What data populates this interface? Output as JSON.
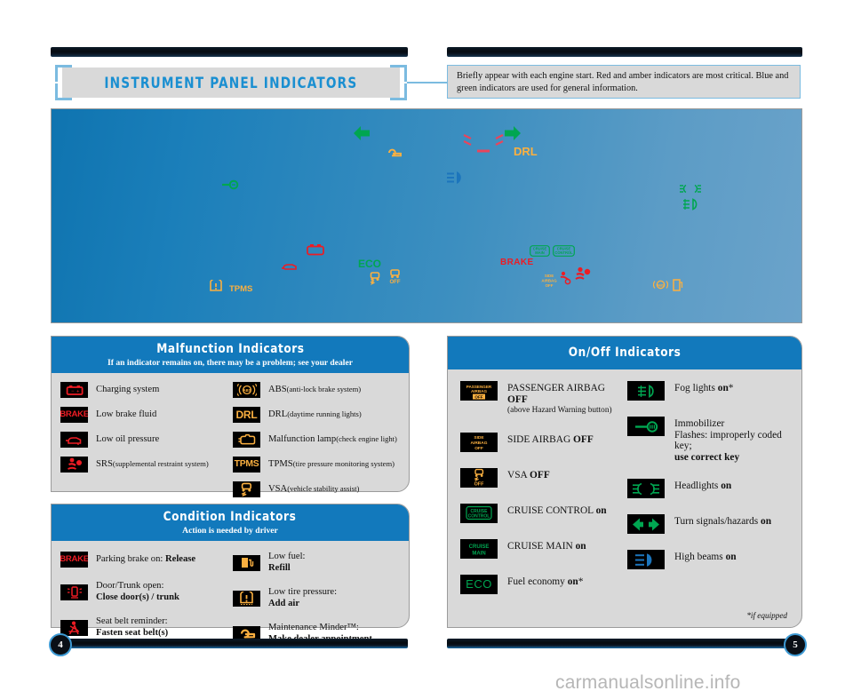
{
  "header": {
    "title": "INSTRUMENT PANEL INDICATORS",
    "callout": "Briefly appear with each engine start. Red and amber indicators are most critical. Blue and green indicators are used for general information."
  },
  "colors": {
    "header_blue": "#1279bc",
    "accent_light_blue": "#7bbbe0",
    "panel_gray": "#d9d9d9",
    "icon_red": "#ED1C24",
    "icon_amber": "#FBB040",
    "icon_green": "#00A651",
    "icon_blue": "#1C75BC",
    "dash_blue": "#1b7fba"
  },
  "dashboard": {
    "name": "instrument-cluster-illustration",
    "symbols": [
      {
        "id": "turn-left-arrow",
        "label": "",
        "color": "#00A651"
      },
      {
        "id": "maintenance-wrench",
        "label": "",
        "color": "#FBB040"
      },
      {
        "id": "seat-belt-pair",
        "label": "",
        "color": "#ED1C24"
      },
      {
        "id": "drl-text",
        "label": "DRL",
        "color": "#FBB040"
      },
      {
        "id": "turn-right-arrow",
        "label": "",
        "color": "#00A651"
      },
      {
        "id": "immobilizer-key",
        "label": "",
        "color": "#00A651"
      },
      {
        "id": "high-beam",
        "label": "",
        "color": "#1C75BC"
      },
      {
        "id": "headlights",
        "label": "",
        "color": "#00A651"
      },
      {
        "id": "fog-lights",
        "label": "",
        "color": "#00A651"
      },
      {
        "id": "low-oil-pressure",
        "label": "",
        "color": "#ED1C24"
      },
      {
        "id": "charging-system",
        "label": "",
        "color": "#ED1C24"
      },
      {
        "id": "eco-text",
        "label": "ECO",
        "color": "#00A651"
      },
      {
        "id": "vsa",
        "label": "",
        "color": "#FBB040"
      },
      {
        "id": "vsa-off",
        "label": "OFF",
        "color": "#FBB040"
      },
      {
        "id": "tpms",
        "label": "TPMS",
        "color": "#FBB040"
      },
      {
        "id": "cruise-main-box",
        "label": "CRUISE MAIN",
        "color": "#00A651"
      },
      {
        "id": "cruise-control-box",
        "label": "CRUISE CONTROL",
        "color": "#00A651"
      },
      {
        "id": "brake-text",
        "label": "BRAKE",
        "color": "#ED1C24"
      },
      {
        "id": "side-airbag-off",
        "label": "SIDE AIRBAG OFF",
        "color": "#FBB040"
      },
      {
        "id": "srs-small",
        "label": "",
        "color": "#ED1C24"
      },
      {
        "id": "srs",
        "label": "",
        "color": "#ED1C24"
      },
      {
        "id": "abs",
        "label": "",
        "color": "#FBB040"
      },
      {
        "id": "low-fuel",
        "label": "",
        "color": "#FBB040"
      }
    ]
  },
  "malfunction": {
    "title": "Malfunction Indicators",
    "subtitle": "If an indicator remains on, there may be a problem; see your dealer",
    "left_items": [
      {
        "icon": "charging-system-icon",
        "label": "Charging system",
        "note": ""
      },
      {
        "icon": "brake-icon",
        "label": "Low brake fluid",
        "note": ""
      },
      {
        "icon": "low-oil-pressure-icon",
        "label": "Low oil pressure",
        "note": ""
      },
      {
        "icon": "srs-icon",
        "label": "SRS",
        "note": "(supplemental restraint system)"
      }
    ],
    "right_items": [
      {
        "icon": "abs-icon",
        "label": "ABS",
        "note": "(anti-lock brake system)"
      },
      {
        "icon": "drl-icon",
        "label": "DRL",
        "note": "(daytime running lights)"
      },
      {
        "icon": "malfunction-lamp-icon",
        "label": "Malfunction lamp",
        "note": "(check engine light)"
      },
      {
        "icon": "tpms-icon",
        "label": "TPMS",
        "note": "(tire pressure monitoring system)"
      },
      {
        "icon": "vsa-icon",
        "label": "VSA",
        "note": "(vehicle stability assist)"
      }
    ]
  },
  "condition": {
    "title": "Condition Indicators",
    "subtitle": "Action is needed by driver",
    "left_items": [
      {
        "icon": "parking-brake-icon",
        "line1": "Parking brake on: ",
        "bold1": "Release",
        "line2": "",
        "bold2": ""
      },
      {
        "icon": "door-trunk-open-icon",
        "line1": "Door/Trunk open:",
        "bold1": "",
        "line2": "",
        "bold2": "Close door(s) / trunk"
      },
      {
        "icon": "seat-belt-icon",
        "line1": "Seat belt reminder:",
        "bold1": "",
        "line2": "",
        "bold2": "Fasten seat belt(s)"
      }
    ],
    "right_items": [
      {
        "icon": "low-fuel-icon",
        "line1": "Low fuel:",
        "bold1": "",
        "line2": "",
        "bold2": "Refill"
      },
      {
        "icon": "low-tire-pressure-icon",
        "line1": "Low tire pressure:",
        "bold1": "",
        "line2": "",
        "bold2": "Add air"
      },
      {
        "icon": "maintenance-minder-icon",
        "line1": "Maintenance Minder™:",
        "bold1": "",
        "line2": "",
        "bold2": "Make dealer appointment"
      }
    ]
  },
  "onoff": {
    "title": "On/Off Indicators",
    "footnote": "*if equipped",
    "left_items": [
      {
        "icon": "passenger-airbag-off-icon",
        "label": "PASSENGER AIRBAG ",
        "bold": "OFF",
        "sub": "(above Hazard Warning button)"
      },
      {
        "icon": "side-airbag-off-icon",
        "label": "SIDE AIRBAG ",
        "bold": "OFF",
        "sub": ""
      },
      {
        "icon": "vsa-off-icon",
        "label": "VSA ",
        "bold": "OFF",
        "sub": ""
      },
      {
        "icon": "cruise-control-icon",
        "label": "CRUISE CONTROL ",
        "bold": "on",
        "sub": ""
      },
      {
        "icon": "cruise-main-icon",
        "label": "CRUISE MAIN ",
        "bold": "on",
        "sub": ""
      },
      {
        "icon": "eco-icon",
        "label": "Fuel economy ",
        "bold": "on",
        "sub": "",
        "star": "*"
      }
    ],
    "right_items": [
      {
        "icon": "fog-lights-icon",
        "label": "Fog lights ",
        "bold": "on",
        "star": "*",
        "sub": "",
        "sub2": ""
      },
      {
        "icon": "immobilizer-icon",
        "label": "Immobilizer",
        "bold": "",
        "sub": "Flashes: improperly coded key;",
        "sub2": "use correct key"
      },
      {
        "icon": "headlights-icon",
        "label": "Headlights ",
        "bold": "on",
        "sub": "",
        "sub2": ""
      },
      {
        "icon": "turn-signals-icon",
        "label": "Turn signals/hazards ",
        "bold": "on",
        "sub": "",
        "sub2": ""
      },
      {
        "icon": "high-beams-icon",
        "label": "High beams ",
        "bold": "on",
        "sub": "",
        "sub2": ""
      }
    ]
  },
  "footer": {
    "page_left": "4",
    "page_right": "5",
    "watermark": "carmanualsonline.info"
  }
}
